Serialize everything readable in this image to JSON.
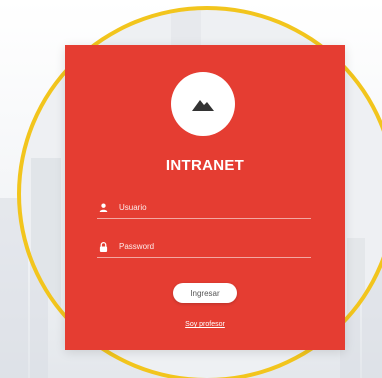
{
  "brand": {
    "title": "INTRANET",
    "logo_icon": "mountain-icon",
    "accent_color": "#e53d32",
    "frame_color": "#f2c51d"
  },
  "form": {
    "username_placeholder": "Usuario",
    "password_placeholder": "Password",
    "submit_label": "Ingresar",
    "teacher_link": "Soy profesor"
  },
  "icons": {
    "username": "user-icon",
    "password": "lock-icon"
  }
}
